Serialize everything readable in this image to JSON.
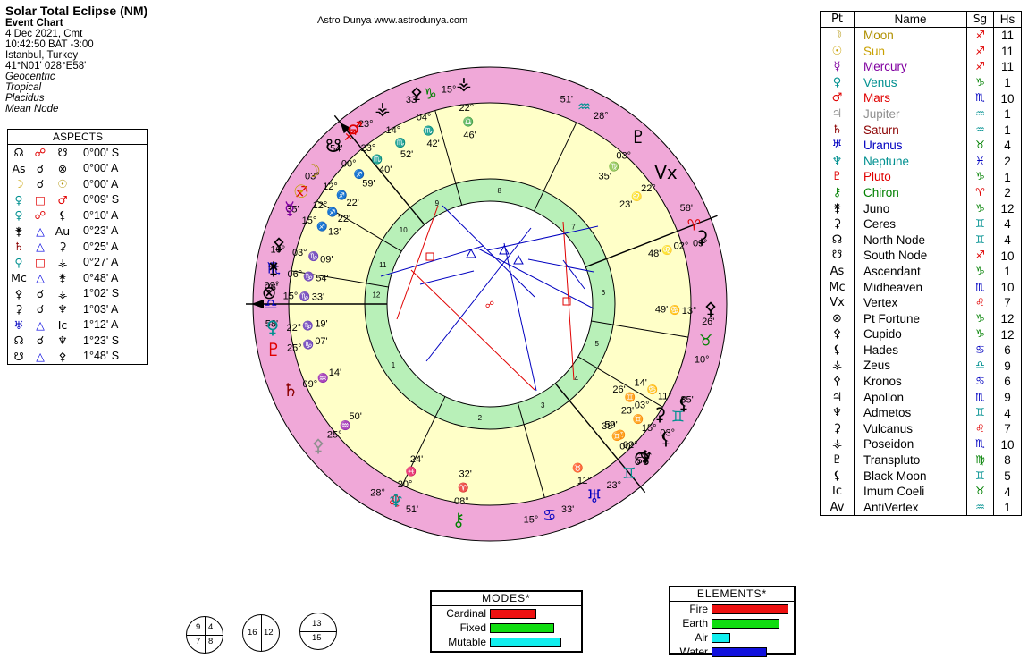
{
  "header": {
    "title": "Solar Total Eclipse (NM)",
    "subtitle": "Event Chart",
    "lines": [
      "4 Dec 2021, Cmt",
      "10:42:50  BAT -3:00",
      "Istanbul, Turkey",
      "41°N01' 028°E58'"
    ],
    "italic_lines": [
      "Geocentric",
      "Tropical",
      "Placidus",
      "Mean Node"
    ]
  },
  "site_credit": "Astro Dunya www.astrodunya.com",
  "aspects": {
    "title": "ASPECTS",
    "rows": [
      {
        "p1": "☊",
        "asp": "☍",
        "p2": "☋",
        "orb": "0°00' S",
        "c1": "#000",
        "c2": "#e00000",
        "c3": "#000"
      },
      {
        "p1": "As",
        "asp": "☌",
        "p2": "⊗",
        "orb": "0°00' A",
        "c1": "#000",
        "c2": "#000",
        "c3": "#000"
      },
      {
        "p1": "☽",
        "asp": "☌",
        "p2": "☉",
        "orb": "0°00' A",
        "c1": "#c8a000",
        "c2": "#000",
        "c3": "#b09000"
      },
      {
        "p1": "♀",
        "asp": "□",
        "p2": "♂",
        "orb": "0°09' S",
        "c1": "#009090",
        "c2": "#e00000",
        "c3": "#e00000"
      },
      {
        "p1": "♀",
        "asp": "☍",
        "p2": "⚸",
        "orb": "0°10' A",
        "c1": "#009090",
        "c2": "#e00000",
        "c3": "#000"
      },
      {
        "p1": "⚵",
        "asp": "△",
        "p2": "Au",
        "orb": "0°23' A",
        "c1": "#000",
        "c2": "#0000e0",
        "c3": "#000"
      },
      {
        "p1": "♄",
        "asp": "△",
        "p2": "⚳",
        "orb": "0°25' A",
        "c1": "#8b0000",
        "c2": "#0000e0",
        "c3": "#000"
      },
      {
        "p1": "♀",
        "asp": "□",
        "p2": "⚶",
        "orb": "0°27' A",
        "c1": "#009090",
        "c2": "#e00000",
        "c3": "#000"
      },
      {
        "p1": "Mc",
        "asp": "△",
        "p2": "⚵",
        "orb": "0°48' A",
        "c1": "#000",
        "c2": "#0000e0",
        "c3": "#000"
      },
      {
        "p1": "⚴",
        "asp": "☌",
        "p2": "⚶",
        "orb": "1°02' S",
        "c1": "#000",
        "c2": "#000",
        "c3": "#000"
      },
      {
        "p1": "⚳",
        "asp": "☌",
        "p2": "♆",
        "orb": "1°03' A",
        "c1": "#000",
        "c2": "#000",
        "c3": "#000"
      },
      {
        "p1": "♅",
        "asp": "△",
        "p2": "Ic",
        "orb": "1°12' A",
        "c1": "#0000c0",
        "c2": "#0000e0",
        "c3": "#000"
      },
      {
        "p1": "☊",
        "asp": "☌",
        "p2": "♆",
        "orb": "1°23' S",
        "c1": "#000",
        "c2": "#000",
        "c3": "#000"
      },
      {
        "p1": "☋",
        "asp": "△",
        "p2": "⚴",
        "orb": "1°48' S",
        "c1": "#000",
        "c2": "#0000e0",
        "c3": "#000"
      }
    ]
  },
  "planets": {
    "headers": [
      "Pt",
      "Name",
      "Sg",
      "Hs"
    ],
    "rows": [
      {
        "glyph": "☽",
        "name": "Moon",
        "sign": "♐",
        "house": "11",
        "color": "#b09000",
        "signColor": "#e00000"
      },
      {
        "glyph": "☉",
        "name": "Sun",
        "sign": "♐",
        "house": "11",
        "color": "#c8a000",
        "signColor": "#e00000"
      },
      {
        "glyph": "☿",
        "name": "Mercury",
        "sign": "♐",
        "house": "11",
        "color": "#8000a0",
        "signColor": "#e00000"
      },
      {
        "glyph": "♀",
        "name": "Venus",
        "sign": "♑",
        "house": "1",
        "color": "#009090",
        "signColor": "#008000"
      },
      {
        "glyph": "♂",
        "name": "Mars",
        "sign": "♏",
        "house": "10",
        "color": "#e00000",
        "signColor": "#0000c0"
      },
      {
        "glyph": "♃",
        "name": "Jupiter",
        "sign": "♒",
        "house": "1",
        "color": "#909090",
        "signColor": "#009090"
      },
      {
        "glyph": "♄",
        "name": "Saturn",
        "sign": "♒",
        "house": "1",
        "color": "#8b0000",
        "signColor": "#009090"
      },
      {
        "glyph": "♅",
        "name": "Uranus",
        "sign": "♉",
        "house": "4",
        "color": "#0000c0",
        "signColor": "#008000"
      },
      {
        "glyph": "♆",
        "name": "Neptune",
        "sign": "♓",
        "house": "2",
        "color": "#009090",
        "signColor": "#0000c0"
      },
      {
        "glyph": "♇",
        "name": "Pluto",
        "sign": "♑",
        "house": "1",
        "color": "#e00000",
        "signColor": "#008000"
      },
      {
        "glyph": "⚷",
        "name": "Chiron",
        "sign": "♈",
        "house": "2",
        "color": "#008000",
        "signColor": "#e00000"
      },
      {
        "glyph": "⚵",
        "name": "Juno",
        "sign": "♑",
        "house": "12",
        "color": "#000",
        "signColor": "#008000"
      },
      {
        "glyph": "⚳",
        "name": "Ceres",
        "sign": "♊",
        "house": "4",
        "color": "#000",
        "signColor": "#009090"
      },
      {
        "glyph": "☊",
        "name": "North Node",
        "sign": "♊",
        "house": "4",
        "color": "#000",
        "signColor": "#009090"
      },
      {
        "glyph": "☋",
        "name": "South Node",
        "sign": "♐",
        "house": "10",
        "color": "#000",
        "signColor": "#e00000"
      },
      {
        "glyph": "As",
        "name": "Ascendant",
        "sign": "♑",
        "house": "1",
        "color": "#000",
        "signColor": "#008000"
      },
      {
        "glyph": "Mc",
        "name": "Midheaven",
        "sign": "♏",
        "house": "10",
        "color": "#000",
        "signColor": "#0000c0"
      },
      {
        "glyph": "Vx",
        "name": "Vertex",
        "sign": "♌",
        "house": "7",
        "color": "#000",
        "signColor": "#e00000"
      },
      {
        "glyph": "⊗",
        "name": "Pt Fortune",
        "sign": "♑",
        "house": "12",
        "color": "#000",
        "signColor": "#008000"
      },
      {
        "glyph": "⚴",
        "name": "Cupido",
        "sign": "♑",
        "house": "12",
        "color": "#000",
        "signColor": "#008000"
      },
      {
        "glyph": "⚸",
        "name": "Hades",
        "sign": "♋",
        "house": "6",
        "color": "#000",
        "signColor": "#0000c0"
      },
      {
        "glyph": "⚶",
        "name": "Zeus",
        "sign": "♎",
        "house": "9",
        "color": "#000",
        "signColor": "#009090"
      },
      {
        "glyph": "⚴",
        "name": "Kronos",
        "sign": "♋",
        "house": "6",
        "color": "#000",
        "signColor": "#0000c0"
      },
      {
        "glyph": "♃",
        "name": "Apollon",
        "sign": "♏",
        "house": "9",
        "color": "#000",
        "signColor": "#0000c0"
      },
      {
        "glyph": "♆",
        "name": "Admetos",
        "sign": "♊",
        "house": "4",
        "color": "#000",
        "signColor": "#009090"
      },
      {
        "glyph": "⚳",
        "name": "Vulcanus",
        "sign": "♌",
        "house": "7",
        "color": "#000",
        "signColor": "#e00000"
      },
      {
        "glyph": "⚶",
        "name": "Poseidon",
        "sign": "♏",
        "house": "10",
        "color": "#000",
        "signColor": "#0000c0"
      },
      {
        "glyph": "♇",
        "name": "Transpluto",
        "sign": "♍",
        "house": "8",
        "color": "#000",
        "signColor": "#008000"
      },
      {
        "glyph": "⚸",
        "name": "Black Moon",
        "sign": "♊",
        "house": "5",
        "color": "#000",
        "signColor": "#009090"
      },
      {
        "glyph": "Ic",
        "name": "Imum Coeli",
        "sign": "♉",
        "house": "4",
        "color": "#000",
        "signColor": "#008000"
      },
      {
        "glyph": "Av",
        "name": "AntiVertex",
        "sign": "♒",
        "house": "1",
        "color": "#000",
        "signColor": "#009090"
      }
    ]
  },
  "modes": {
    "title": "MODES*",
    "items": [
      {
        "label": "Cardinal",
        "fraction": 0.65,
        "color": "#ee1111"
      },
      {
        "label": "Fixed",
        "fraction": 0.9,
        "color": "#11dd11"
      },
      {
        "label": "Mutable",
        "fraction": 1.0,
        "color": "#11eeee"
      }
    ]
  },
  "elements": {
    "title": "ELEMENTS*",
    "items": [
      {
        "label": "Fire",
        "fraction": 1.0,
        "color": "#ee1111"
      },
      {
        "label": "Earth",
        "fraction": 0.88,
        "color": "#11dd11"
      },
      {
        "label": "Air",
        "fraction": 0.24,
        "color": "#11eeee"
      },
      {
        "label": "Water",
        "fraction": 0.72,
        "color": "#1111dd"
      }
    ]
  },
  "quadrants": {
    "left": [
      "9",
      "4",
      "7",
      "8"
    ],
    "middle": [
      "16",
      "12"
    ],
    "right": [
      "13",
      "15"
    ]
  },
  "wheel": {
    "colors": {
      "outer_ring": "#f0a8d8",
      "house_fill": "#ffffc8",
      "inner_ring": "#b8f0b8"
    },
    "sign_labels": [
      {
        "deg": "09°",
        "glyph": "♎",
        "min": "58'",
        "color": "#0000c0"
      },
      {
        "deg": "28°",
        "glyph": "♌",
        "min": "51'",
        "color": "#e00000"
      },
      {
        "deg": "15°",
        "glyph": "♋",
        "min": "33'",
        "color": "#0000c0"
      },
      {
        "deg": "23°",
        "glyph": "♊",
        "min": "54'",
        "color": "#009090"
      },
      {
        "deg": "03°",
        "glyph": "♊",
        "min": "35'",
        "color": "#009090"
      },
      {
        "deg": "10°",
        "glyph": "♉",
        "min": "26'",
        "color": "#008000"
      },
      {
        "deg": "09°",
        "glyph": "♈",
        "min": "58'",
        "color": "#e00000"
      },
      {
        "deg": "28°",
        "glyph": "♒",
        "min": "51'",
        "color": "#009090"
      },
      {
        "deg": "15°",
        "glyph": "♑",
        "min": "33'",
        "color": "#008000"
      },
      {
        "deg": "23°",
        "glyph": "♐",
        "min": "54'",
        "color": "#e00000"
      },
      {
        "deg": "03°",
        "glyph": "♐",
        "min": "35'",
        "color": "#e00000"
      },
      {
        "deg": "10°",
        "glyph": "♏",
        "min": "26'",
        "color": "#0000c0"
      }
    ],
    "house_numbers": [
      "1",
      "2",
      "3",
      "4",
      "5",
      "6",
      "7",
      "8",
      "9",
      "10",
      "11",
      "12"
    ],
    "planet_labels": [
      {
        "glyph": "⚶",
        "color": "#000",
        "deg": "22°",
        "sign": "♎",
        "min": "46'"
      },
      {
        "glyph": "⚴",
        "color": "#000",
        "deg": "04°",
        "sign": "♏",
        "min": "42'"
      },
      {
        "glyph": "♇",
        "color": "#000",
        "deg": "03°",
        "sign": "♍",
        "min": "35'"
      },
      {
        "glyph": "Vx",
        "color": "#000",
        "deg": "22°",
        "sign": "♌",
        "min": "23'"
      },
      {
        "glyph": "⚳",
        "color": "#000",
        "deg": "02°",
        "sign": "♌",
        "min": "48'"
      },
      {
        "glyph": "⚴",
        "color": "#000",
        "deg": "13°",
        "sign": "♋",
        "min": "49'"
      },
      {
        "glyph": "⚸",
        "color": "#000",
        "deg": "11°",
        "sign": "♋",
        "min": "14'"
      },
      {
        "glyph": "⚸",
        "color": "#000",
        "deg": "15°",
        "sign": "♊",
        "min": "23'"
      },
      {
        "glyph": "⚳",
        "color": "#000",
        "deg": "03°",
        "sign": "♊",
        "min": "26'"
      },
      {
        "glyph": "♆",
        "color": "#000",
        "deg": "02°",
        "sign": "♊",
        "min": "59'"
      },
      {
        "glyph": "☊",
        "color": "#000",
        "deg": "00°",
        "sign": "♊",
        "min": "38'"
      },
      {
        "glyph": "♅",
        "color": "#0000c0",
        "deg": "11°",
        "sign": "♉",
        "min": ""
      },
      {
        "glyph": "⚷",
        "color": "#008000",
        "deg": "08°",
        "sign": "♈",
        "min": "32'"
      },
      {
        "glyph": "♆",
        "color": "#009090",
        "deg": "20°",
        "sign": "♓",
        "min": "24'"
      },
      {
        "glyph": "⚴",
        "color": "#909090",
        "deg": "25°",
        "sign": "♒",
        "min": "50'"
      },
      {
        "glyph": "♄",
        "color": "#8b0000",
        "deg": "09°",
        "sign": "♒",
        "min": "14'"
      },
      {
        "glyph": "♇",
        "color": "#e00000",
        "deg": "25°",
        "sign": "♑",
        "min": "07'"
      },
      {
        "glyph": "♀",
        "color": "#009090",
        "deg": "22°",
        "sign": "♑",
        "min": "19'"
      },
      {
        "glyph": "⊗",
        "color": "#000",
        "deg": "15°",
        "sign": "♑",
        "min": "33'"
      },
      {
        "glyph": "⚵",
        "color": "#000",
        "deg": "06°",
        "sign": "♑",
        "min": "54'"
      },
      {
        "glyph": "⚴",
        "color": "#000",
        "deg": "03°",
        "sign": "♑",
        "min": "09'"
      },
      {
        "glyph": "☿",
        "color": "#8000a0",
        "deg": "15°",
        "sign": "♐",
        "min": "13'"
      },
      {
        "glyph": "☉",
        "color": "#c8a000",
        "deg": "12°",
        "sign": "♐",
        "min": "22'"
      },
      {
        "glyph": "☽",
        "color": "#b09000",
        "deg": "12°",
        "sign": "♐",
        "min": "22'"
      },
      {
        "glyph": "☋",
        "color": "#000",
        "deg": "00°",
        "sign": "♐",
        "min": "59'"
      },
      {
        "glyph": "♂",
        "color": "#e00000",
        "deg": "23°",
        "sign": "♏",
        "min": "40'"
      },
      {
        "glyph": "⚶",
        "color": "#000",
        "deg": "14°",
        "sign": "♏",
        "min": "52'"
      }
    ]
  }
}
